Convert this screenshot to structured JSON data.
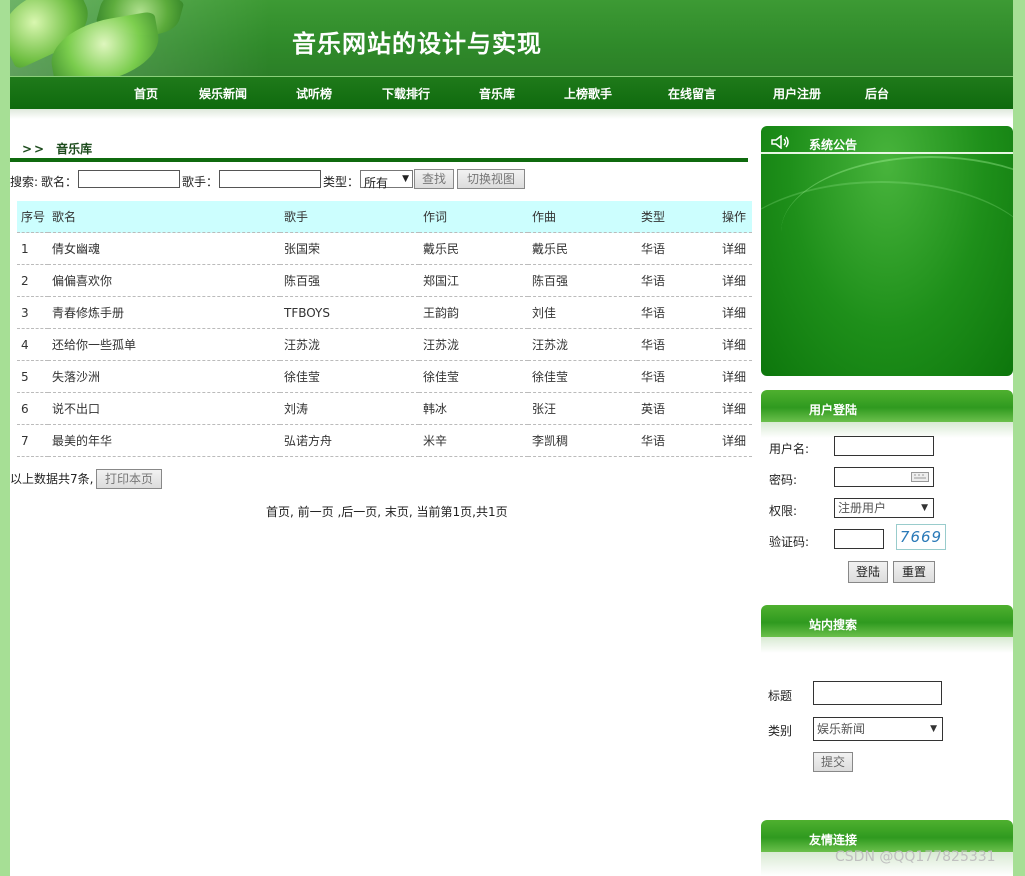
{
  "header": {
    "title": "音乐网站的设计与实现"
  },
  "nav": [
    {
      "label": "首页"
    },
    {
      "label": "娱乐新闻"
    },
    {
      "label": "试听榜"
    },
    {
      "label": "下载排行"
    },
    {
      "label": "音乐库"
    },
    {
      "label": "上榜歌手"
    },
    {
      "label": "在线留言"
    },
    {
      "label": "用户注册"
    },
    {
      "label": "后台"
    }
  ],
  "breadcrumb": {
    "arrows": ">>",
    "label": "音乐库"
  },
  "search": {
    "prefix": "搜索:",
    "song_label": "歌名：",
    "singer_label": "歌手：",
    "type_label": "类型：",
    "type_selected": "所有",
    "find_button": "查找",
    "switch_button": "切换视图"
  },
  "table": {
    "headers": [
      "序号",
      "歌名",
      "歌手",
      "作词",
      "作曲",
      "类型",
      "操作"
    ],
    "rows": [
      [
        "1",
        "倩女幽魂",
        "张国荣",
        "戴乐民",
        "戴乐民",
        "华语",
        "详细"
      ],
      [
        "2",
        "偏偏喜欢你",
        "陈百强",
        "郑国江",
        "陈百强",
        "华语",
        "详细"
      ],
      [
        "3",
        "青春修炼手册",
        "TFBOYS",
        "王韵韵",
        "刘佳",
        "华语",
        "详细"
      ],
      [
        "4",
        "还给你一些孤单",
        "汪苏泷",
        "汪苏泷",
        "汪苏泷",
        "华语",
        "详细"
      ],
      [
        "5",
        "失落沙洲",
        "徐佳莹",
        "徐佳莹",
        "徐佳莹",
        "华语",
        "详细"
      ],
      [
        "6",
        "说不出口",
        "刘涛",
        "韩冰",
        "张汪",
        "英语",
        "详细"
      ],
      [
        "7",
        "最美的年华",
        "弘诺方舟",
        "米辛",
        "李凯稠",
        "华语",
        "详细"
      ]
    ]
  },
  "summary": {
    "text": "以上数据共7条,",
    "print_button": "打印本页"
  },
  "pager": {
    "text": "首页, 前一页 ,后一页, 末页, 当前第1页,共1页"
  },
  "sidebar": {
    "notice_title": "系统公告",
    "login": {
      "title": "用户登陆",
      "username_label": "用户名:",
      "password_label": "密码:",
      "role_label": "权限:",
      "role_selected": "注册用户",
      "captcha_label": "验证码:",
      "captcha_value": "7669",
      "login_button": "登陆",
      "reset_button": "重置"
    },
    "site_search": {
      "title": "站内搜索",
      "title_label": "标题",
      "category_label": "类别",
      "category_selected": "娱乐新闻",
      "submit_button": "提交"
    },
    "links_title": "友情连接"
  },
  "watermark": "CSDN @QQ177825331"
}
